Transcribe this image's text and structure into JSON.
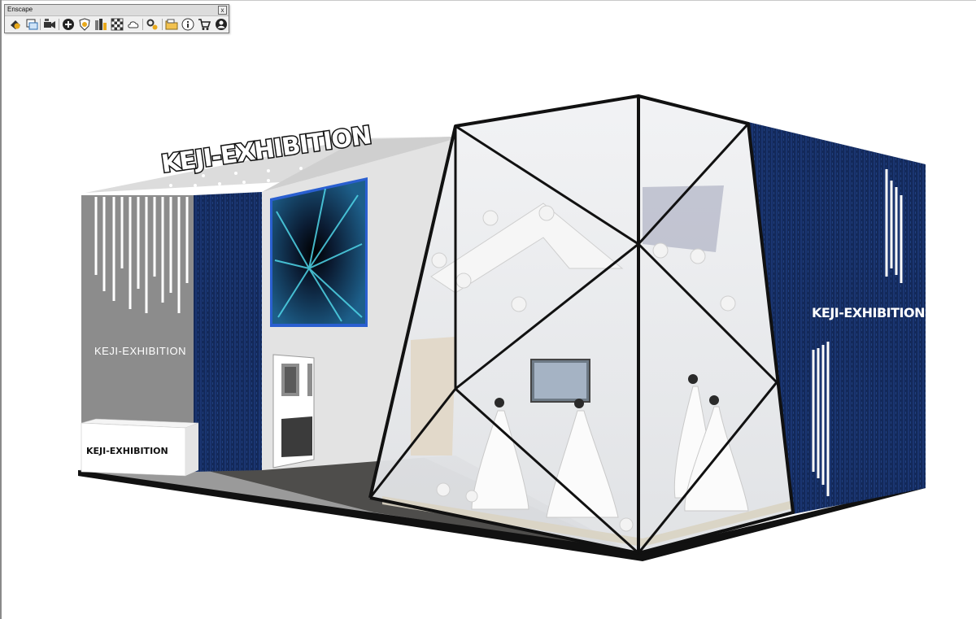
{
  "toolbar": {
    "title": "Enscape",
    "close_glyph": "x",
    "buttons": [
      {
        "name": "start-enscape",
        "icon": "enscape-start-icon"
      },
      {
        "name": "synchronize-views",
        "icon": "sync-views-icon"
      },
      {
        "name": "capture-screenshot",
        "icon": "camera-icon"
      },
      {
        "name": "create-view",
        "icon": "add-circle-icon"
      },
      {
        "name": "asset-library",
        "icon": "shield-asset-icon"
      },
      {
        "name": "batch-rendering",
        "icon": "batch-render-icon"
      },
      {
        "name": "material-editor",
        "icon": "checker-icon"
      },
      {
        "name": "upload",
        "icon": "cloud-upload-icon"
      },
      {
        "name": "settings",
        "icon": "settings-gear-icon"
      },
      {
        "name": "open-folder",
        "icon": "folder-icon"
      },
      {
        "name": "about",
        "icon": "info-icon"
      },
      {
        "name": "store",
        "icon": "cart-icon"
      },
      {
        "name": "account",
        "icon": "user-account-icon"
      }
    ]
  },
  "scene": {
    "roof_sign": "KEJI-EXHIBITION",
    "left_wall_text": "KEJI-EXHIBITION",
    "reception_desk_text": "KEJI-EXHIBITION",
    "right_wall_text": "KEJI-EXHIBITION",
    "colors": {
      "navy_panel": "#13295a",
      "grey_wall": "#8a8a8a",
      "glass": "#e9ebee",
      "frame": "#111111"
    }
  }
}
